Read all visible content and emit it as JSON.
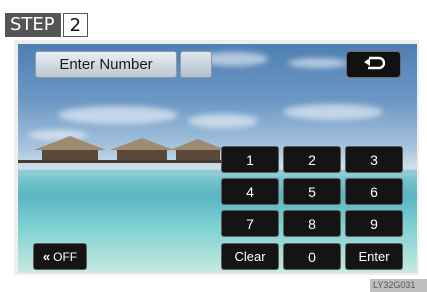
{
  "step": {
    "word": "STEP",
    "number": "2"
  },
  "header": {
    "enter_number_label": "Enter Number",
    "back_icon": "return-arrow-icon"
  },
  "keypad": {
    "rows": [
      [
        "1",
        "2",
        "3"
      ],
      [
        "4",
        "5",
        "6"
      ],
      [
        "7",
        "8",
        "9"
      ],
      [
        "Clear",
        "0",
        "Enter"
      ]
    ]
  },
  "footer": {
    "off_label": "OFF",
    "off_icon": "double-chevron-left-icon"
  },
  "figure_code": "LY32G031"
}
